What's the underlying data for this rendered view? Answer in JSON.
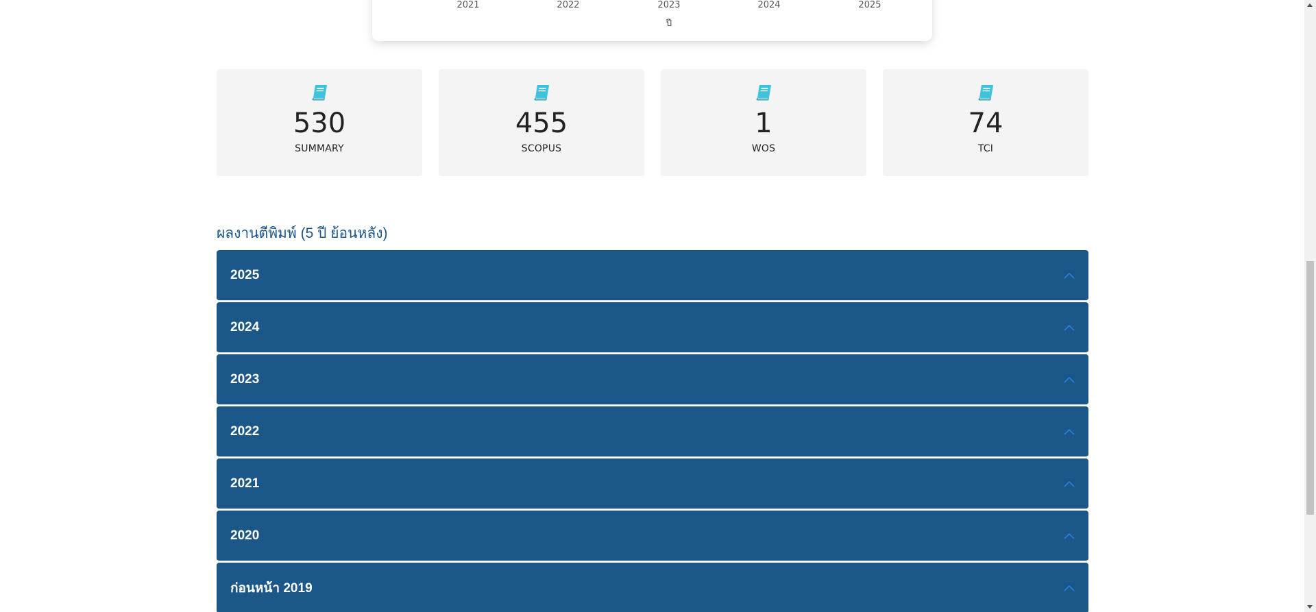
{
  "chart": {
    "x_ticks": [
      "2021",
      "2022",
      "2023",
      "2024",
      "2025"
    ],
    "x_axis_title": "ปี"
  },
  "stats": [
    {
      "value": "530",
      "label": "SUMMARY",
      "icon": "book-icon"
    },
    {
      "value": "455",
      "label": "SCOPUS",
      "icon": "book-icon"
    },
    {
      "value": "1",
      "label": "WOS",
      "icon": "book-icon"
    },
    {
      "value": "74",
      "label": "TCI",
      "icon": "book-icon"
    }
  ],
  "section": {
    "title": "ผลงานตีพิมพ์ (5 ปี ย้อนหลัง)"
  },
  "accordion": [
    {
      "label": "2025"
    },
    {
      "label": "2024"
    },
    {
      "label": "2023"
    },
    {
      "label": "2022"
    },
    {
      "label": "2021"
    },
    {
      "label": "2020"
    },
    {
      "label": "ก่อนหน้า 2019"
    }
  ],
  "colors": {
    "accordion_bg": "#1b5789",
    "heading": "#1b5589",
    "icon": "#3cc3de",
    "card_bg": "#f4f4f4",
    "chevron": "#2a7fd6"
  }
}
